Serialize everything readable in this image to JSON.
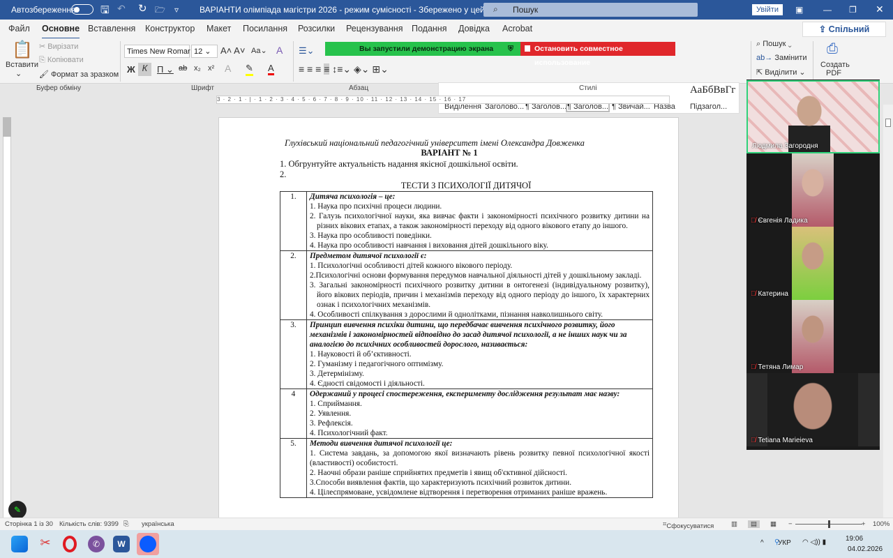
{
  "titlebar": {
    "autosave": "Автозбереження",
    "title": "ВАРІАНТИ олімпіада  магістри 2026  -  режим сумісності  -  Збережено у цей ПК ▾",
    "search_placeholder": "Пошук",
    "signin": "Увійти"
  },
  "tabs": [
    "Файл",
    "Основне",
    "Вставлення",
    "Конструктор",
    "Макет",
    "Посилання",
    "Розсилки",
    "Рецензування",
    "Подання",
    "Довідка",
    "Acrobat"
  ],
  "share": "Спільний доступ",
  "ribbon": {
    "paste": "Вставити",
    "cut": "Вирізати",
    "copy": "Копіювати",
    "format_painter": "Формат за зразком",
    "clipboard": "Буфер обміну",
    "font_name": "Times New Romar",
    "font_size": "12",
    "font": "Шрифт",
    "paragraph": "Абзац",
    "styles_group": "Стилі",
    "styles": [
      "Виділення",
      "Заголово...",
      "¶ Заголов...",
      "¶ Заголов...",
      "¶ Звичай...",
      "Назва",
      "Підзагол..."
    ],
    "style_preview": "АаБбВвГг",
    "find": "Пошук",
    "replace": "Замінити",
    "select": "Виділити",
    "create_pdf": "Создать PDF"
  },
  "share_banner": {
    "running": "Вы запустили демонстрацию экрана",
    "stop": "Остановить совместное использование"
  },
  "ruler": "3 · 2 · 1 · | · 1 · 2 · 3 · 4 · 5 · 6 · 7 · 8 · 9 · 10 · 11 · 12 · 13 · 14 · 15 · 16 · 17",
  "doc": {
    "university": "Глухівський національний педагогічний  університет імені Олександра Довженка",
    "variant": "ВАРІАНТ  № 1",
    "task1": "1. Обгрунтуйте актуальність надання якісної дошкільної освіти.",
    "task2": "2.",
    "tests_title": "ТЕСТИ З ПСИХОЛОГІЇ ДИТЯЧОЇ",
    "questions": [
      {
        "num": "1.",
        "q": "Дитяча психологія – це:",
        "options": [
          "1. Наука про психічні процеси людини.",
          "2. Галузь психологічної науки, яка вивчає факти і закономірності психічного розвитку дитини на різних вікових етапах, а також закономірності переходу від одного вікового етапу до іншого.",
          "3. Наука про особливості поведінки.",
          "4. Наука про особливості навчання і виховання дітей дошкільного віку."
        ]
      },
      {
        "num": "2.",
        "q": "Предметом дитячої психології є:",
        "options": [
          "1. Психологічні особливості дітей кожного вікового періоду.",
          "2.Психологічні основи формування передумов навчальної діяльності дітей у дошкільному закладі.",
          "3. Загальні закономірності психічного розвитку дитини в онтогенезі (індивідуальному розвитку), його вікових періодів, причин і механізмів переходу від одного періоду до іншого, їх характерних ознак і психологічних механізмів.",
          "4. Особливості спілкування з дорослими й однолітками, пізнання навколишнього світу."
        ]
      },
      {
        "num": "3.",
        "q": "Принцип вивчення психіки дитини, що передбачає вивчення психічного розвитку, його механізмів і закономірностей відповідно до засад дитячої психології, а не інших наук чи за аналогією до психічних особливостей дорослого, називається:",
        "options": [
          "1. Науковості й об’єктивності.",
          "2. Гуманізму і педагогічного оптимізму.",
          "3. Детермінізму.",
          "4. Єдності свідомості і діяльності."
        ]
      },
      {
        "num": "4",
        "q": "Одержаний у процесі спостереження, експерименту дослідження результат має назву:",
        "options": [
          "1. Сприймання.",
          "2. Уявлення.",
          "3. Рефлексія.",
          "4. Психологічний факт."
        ]
      },
      {
        "num": "5.",
        "q": "Методи вивчення дитячої психології це:",
        "options": [
          " 1. Система завдань, за допомогою якої визначають рівень розвитку певної психологічної якості (властивості) особистості.",
          "2. Наочні образи раніше сприйнятих предметів і явищ об'єктивної дійсності.",
          "3.Способи виявлення фактів, що характеризують психічний розвиток дитини.",
          "4. Цілеспрямоване, усвідомлене відтворення і перетворення отриманих раніше вражень."
        ]
      }
    ]
  },
  "participants": [
    {
      "name": "Людмила Загородня",
      "active": true
    },
    {
      "name": "Євгенія Ладика"
    },
    {
      "name": "Катерина"
    },
    {
      "name": "Тетяна Лимар"
    },
    {
      "name": "Tetiana Marieieva"
    }
  ],
  "status": {
    "page": "Сторінка 1 із 30",
    "words": "Кількість слів: 9399",
    "lang": "українська",
    "focus": "Сфокусуватися",
    "zoom": "100%",
    "zoom_level": 100
  },
  "taskbar": {
    "lang": "УКР",
    "time": "19:06",
    "date": "04.02.2026"
  }
}
